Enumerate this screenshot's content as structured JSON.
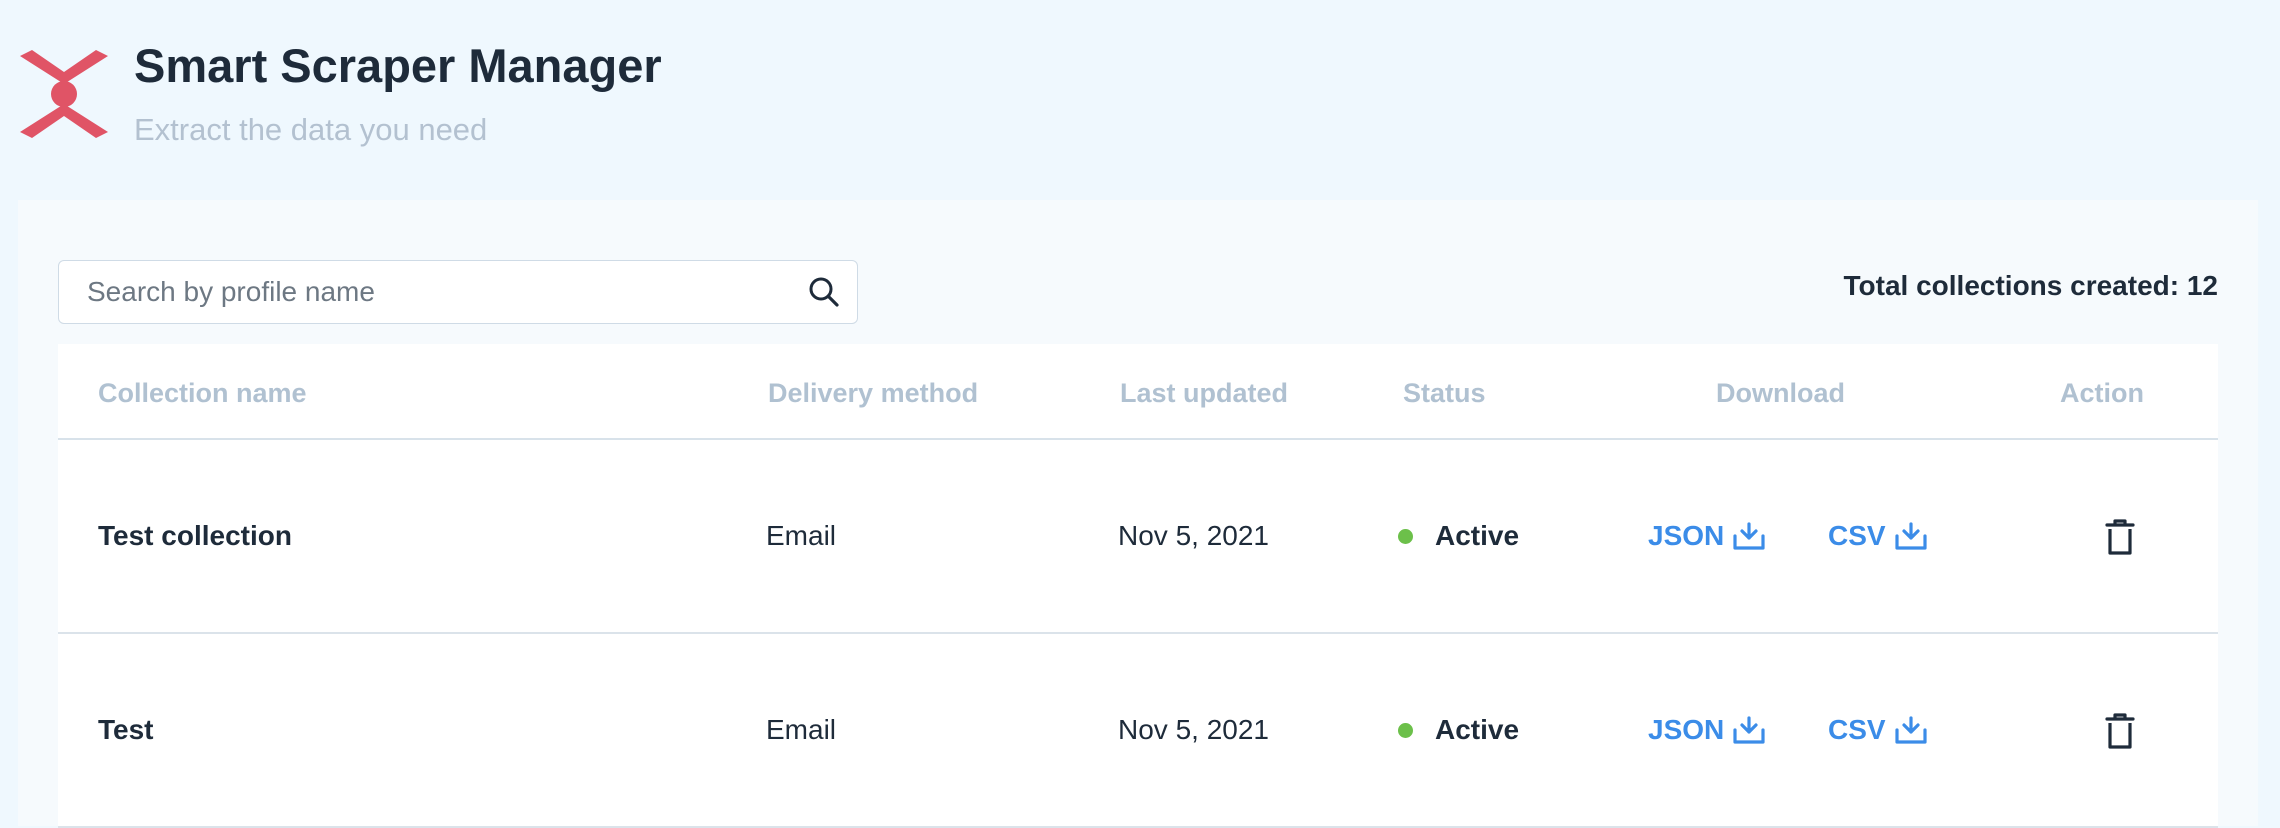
{
  "app": {
    "title": "Smart Scraper Manager",
    "subtitle": "Extract the data you need",
    "brand_color": "#e05466"
  },
  "search": {
    "placeholder": "Search by profile name",
    "value": "",
    "icon": "search-icon"
  },
  "summary": {
    "label": "Total collections created:",
    "count": "12"
  },
  "table": {
    "columns": {
      "name": "Collection name",
      "delivery": "Delivery method",
      "updated": "Last updated",
      "status": "Status",
      "download": "Download",
      "action": "Action"
    },
    "rows": [
      {
        "name": "Test collection",
        "delivery": "Email",
        "updated": "Nov 5, 2021",
        "status": "Active",
        "status_color": "#6cc04a",
        "download_json": "JSON",
        "download_csv": "CSV",
        "action_icon": "trash-icon"
      },
      {
        "name": "Test",
        "delivery": "Email",
        "updated": "Nov 5, 2021",
        "status": "Active",
        "status_color": "#6cc04a",
        "download_json": "JSON",
        "download_csv": "CSV",
        "action_icon": "trash-icon"
      }
    ]
  },
  "colors": {
    "link": "#3b8ce8",
    "header_text": "#b0c1d1",
    "text": "#1e2b3a"
  }
}
